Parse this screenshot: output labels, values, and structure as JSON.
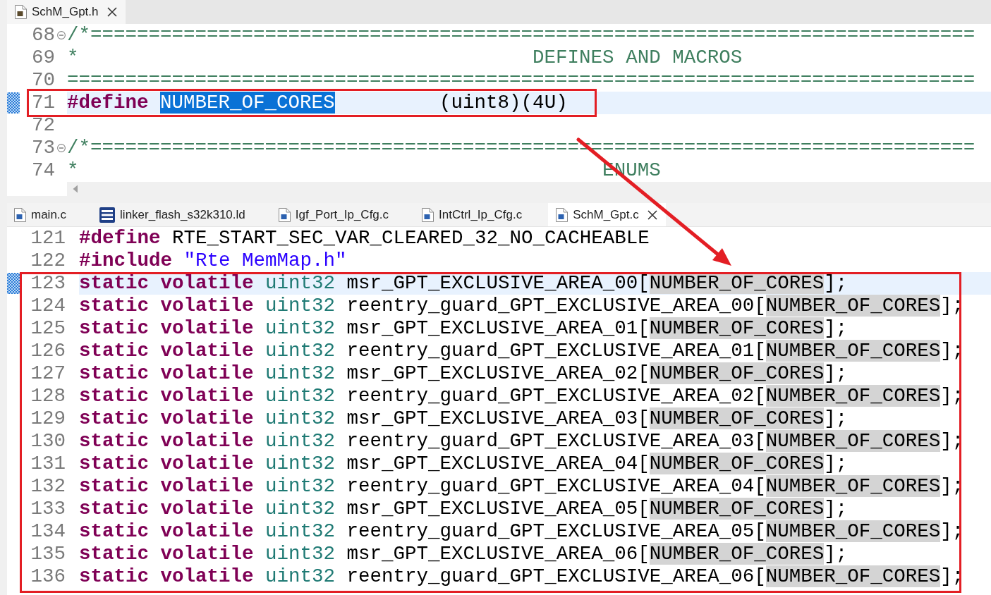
{
  "top_editor": {
    "tabs": [
      {
        "label": "SchM_Gpt.h",
        "kind": "header",
        "selected": true
      }
    ],
    "lines": [
      {
        "number": "68",
        "fold": true,
        "current": false,
        "marked": false,
        "tokens": [
          {
            "kind": "comment",
            "text": "/*============================================================================"
          }
        ]
      },
      {
        "number": "69",
        "fold": false,
        "current": false,
        "marked": false,
        "tokens": [
          {
            "kind": "comment",
            "text": "*                                       DEFINES AND MACROS"
          }
        ]
      },
      {
        "number": "70",
        "fold": false,
        "current": false,
        "marked": false,
        "tokens": [
          {
            "kind": "comment",
            "text": "=============================================================================="
          }
        ]
      },
      {
        "number": "71",
        "fold": false,
        "current": true,
        "marked": true,
        "tokens": [
          {
            "kind": "keyword",
            "text": "#define "
          },
          {
            "kind": "selection",
            "text": "NUMBER_OF_CORES"
          },
          {
            "kind": "plain",
            "text": "         (uint8)(4U)"
          }
        ]
      },
      {
        "number": "72",
        "fold": false,
        "current": false,
        "marked": false
      },
      {
        "number": "73",
        "fold": true,
        "current": false,
        "marked": false,
        "tokens": [
          {
            "kind": "comment",
            "text": "/*============================================================================"
          }
        ]
      },
      {
        "number": "74",
        "fold": false,
        "current": false,
        "marked": false,
        "tokens": [
          {
            "kind": "comment",
            "text": "*                                             ENUMS"
          }
        ]
      }
    ]
  },
  "bottom_editor": {
    "tabs": [
      {
        "label": "main.c",
        "kind": "source",
        "selected": false
      },
      {
        "label": "linker_flash_s32k310.ld",
        "kind": "linker",
        "selected": false
      },
      {
        "label": "Igf_Port_Ip_Cfg.c",
        "kind": "source",
        "selected": false
      },
      {
        "label": "IntCtrl_Ip_Cfg.c",
        "kind": "source",
        "selected": false
      },
      {
        "label": "SchM_Gpt.c",
        "kind": "source",
        "selected": true
      }
    ],
    "lines": [
      {
        "number": "121",
        "fold": false,
        "current": false,
        "marked": false,
        "tokens": [
          {
            "kind": "keyword",
            "text": "#define"
          },
          {
            "kind": "plain",
            "text": " RTE_START_SEC_VAR_CLEARED_32_NO_CACHEABLE"
          }
        ]
      },
      {
        "number": "122",
        "fold": false,
        "current": false,
        "marked": false,
        "tokens": [
          {
            "kind": "keyword",
            "text": "#include "
          },
          {
            "kind": "string",
            "text": "\"Rte MemMap.h\""
          }
        ]
      },
      {
        "number": "123",
        "fold": false,
        "current": true,
        "marked": true,
        "tokens": [
          {
            "kind": "keyword",
            "text": "static volatile "
          },
          {
            "kind": "type",
            "text": "uint32"
          },
          {
            "kind": "plain",
            "text": " msr_GPT_EXCLUSIVE_AREA_00["
          },
          {
            "kind": "occurrence",
            "text": "NUMBER_OF_CORES"
          },
          {
            "kind": "plain",
            "text": "];"
          }
        ]
      },
      {
        "number": "124",
        "fold": false,
        "current": false,
        "marked": false,
        "tokens": [
          {
            "kind": "keyword",
            "text": "static volatile "
          },
          {
            "kind": "type",
            "text": "uint32"
          },
          {
            "kind": "plain",
            "text": " reentry_guard_GPT_EXCLUSIVE_AREA_00["
          },
          {
            "kind": "occurrence",
            "text": "NUMBER_OF_CORES"
          },
          {
            "kind": "plain",
            "text": "];"
          }
        ]
      },
      {
        "number": "125",
        "fold": false,
        "current": false,
        "marked": false,
        "tokens": [
          {
            "kind": "keyword",
            "text": "static volatile "
          },
          {
            "kind": "type",
            "text": "uint32"
          },
          {
            "kind": "plain",
            "text": " msr_GPT_EXCLUSIVE_AREA_01["
          },
          {
            "kind": "occurrence",
            "text": "NUMBER_OF_CORES"
          },
          {
            "kind": "plain",
            "text": "];"
          }
        ]
      },
      {
        "number": "126",
        "fold": false,
        "current": false,
        "marked": false,
        "tokens": [
          {
            "kind": "keyword",
            "text": "static volatile "
          },
          {
            "kind": "type",
            "text": "uint32"
          },
          {
            "kind": "plain",
            "text": " reentry_guard_GPT_EXCLUSIVE_AREA_01["
          },
          {
            "kind": "occurrence",
            "text": "NUMBER_OF_CORES"
          },
          {
            "kind": "plain",
            "text": "];"
          }
        ]
      },
      {
        "number": "127",
        "fold": false,
        "current": false,
        "marked": false,
        "tokens": [
          {
            "kind": "keyword",
            "text": "static volatile "
          },
          {
            "kind": "type",
            "text": "uint32"
          },
          {
            "kind": "plain",
            "text": " msr_GPT_EXCLUSIVE_AREA_02["
          },
          {
            "kind": "occurrence",
            "text": "NUMBER_OF_CORES"
          },
          {
            "kind": "plain",
            "text": "];"
          }
        ]
      },
      {
        "number": "128",
        "fold": false,
        "current": false,
        "marked": false,
        "tokens": [
          {
            "kind": "keyword",
            "text": "static volatile "
          },
          {
            "kind": "type",
            "text": "uint32"
          },
          {
            "kind": "plain",
            "text": " reentry_guard_GPT_EXCLUSIVE_AREA_02["
          },
          {
            "kind": "occurrence",
            "text": "NUMBER_OF_CORES"
          },
          {
            "kind": "plain",
            "text": "];"
          }
        ]
      },
      {
        "number": "129",
        "fold": false,
        "current": false,
        "marked": false,
        "tokens": [
          {
            "kind": "keyword",
            "text": "static volatile "
          },
          {
            "kind": "type",
            "text": "uint32"
          },
          {
            "kind": "plain",
            "text": " msr_GPT_EXCLUSIVE_AREA_03["
          },
          {
            "kind": "occurrence",
            "text": "NUMBER_OF_CORES"
          },
          {
            "kind": "plain",
            "text": "];"
          }
        ]
      },
      {
        "number": "130",
        "fold": false,
        "current": false,
        "marked": false,
        "tokens": [
          {
            "kind": "keyword",
            "text": "static volatile "
          },
          {
            "kind": "type",
            "text": "uint32"
          },
          {
            "kind": "plain",
            "text": " reentry_guard_GPT_EXCLUSIVE_AREA_03["
          },
          {
            "kind": "occurrence",
            "text": "NUMBER_OF_CORES"
          },
          {
            "kind": "plain",
            "text": "];"
          }
        ]
      },
      {
        "number": "131",
        "fold": false,
        "current": false,
        "marked": false,
        "tokens": [
          {
            "kind": "keyword",
            "text": "static volatile "
          },
          {
            "kind": "type",
            "text": "uint32"
          },
          {
            "kind": "plain",
            "text": " msr_GPT_EXCLUSIVE_AREA_04["
          },
          {
            "kind": "occurrence",
            "text": "NUMBER_OF_CORES"
          },
          {
            "kind": "plain",
            "text": "];"
          }
        ]
      },
      {
        "number": "132",
        "fold": false,
        "current": false,
        "marked": false,
        "tokens": [
          {
            "kind": "keyword",
            "text": "static volatile "
          },
          {
            "kind": "type",
            "text": "uint32"
          },
          {
            "kind": "plain",
            "text": " reentry_guard_GPT_EXCLUSIVE_AREA_04["
          },
          {
            "kind": "occurrence",
            "text": "NUMBER_OF_CORES"
          },
          {
            "kind": "plain",
            "text": "];"
          }
        ]
      },
      {
        "number": "133",
        "fold": false,
        "current": false,
        "marked": false,
        "tokens": [
          {
            "kind": "keyword",
            "text": "static volatile "
          },
          {
            "kind": "type",
            "text": "uint32"
          },
          {
            "kind": "plain",
            "text": " msr_GPT_EXCLUSIVE_AREA_05["
          },
          {
            "kind": "occurrence",
            "text": "NUMBER_OF_CORES"
          },
          {
            "kind": "plain",
            "text": "];"
          }
        ]
      },
      {
        "number": "134",
        "fold": false,
        "current": false,
        "marked": false,
        "tokens": [
          {
            "kind": "keyword",
            "text": "static volatile "
          },
          {
            "kind": "type",
            "text": "uint32"
          },
          {
            "kind": "plain",
            "text": " reentry_guard_GPT_EXCLUSIVE_AREA_05["
          },
          {
            "kind": "occurrence",
            "text": "NUMBER_OF_CORES"
          },
          {
            "kind": "plain",
            "text": "];"
          }
        ]
      },
      {
        "number": "135",
        "fold": false,
        "current": false,
        "marked": false,
        "tokens": [
          {
            "kind": "keyword",
            "text": "static volatile "
          },
          {
            "kind": "type",
            "text": "uint32"
          },
          {
            "kind": "plain",
            "text": " msr_GPT_EXCLUSIVE_AREA_06["
          },
          {
            "kind": "occurrence",
            "text": "NUMBER_OF_CORES"
          },
          {
            "kind": "plain",
            "text": "];"
          }
        ]
      },
      {
        "number": "136",
        "fold": false,
        "current": false,
        "marked": false,
        "tokens": [
          {
            "kind": "keyword",
            "text": "static volatile "
          },
          {
            "kind": "type",
            "text": "uint32"
          },
          {
            "kind": "plain",
            "text": " reentry_guard_GPT_EXCLUSIVE_AREA_06["
          },
          {
            "kind": "occurrence",
            "text": "NUMBER_OF_CORES"
          },
          {
            "kind": "plain",
            "text": "];"
          }
        ]
      }
    ]
  }
}
